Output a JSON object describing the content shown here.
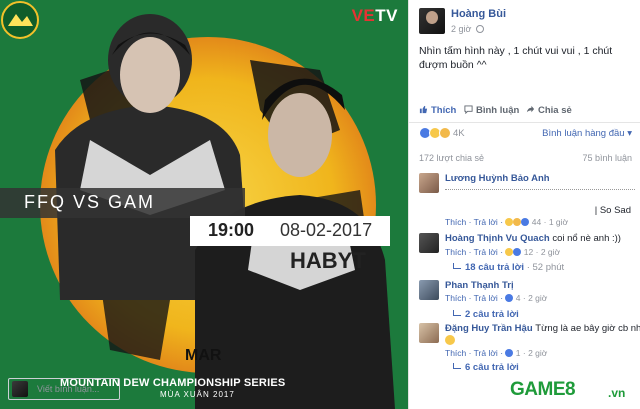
{
  "poster": {
    "watermark_brand": "VE",
    "watermark_brand_tv": "TV",
    "matchup": "FFQ VS GAM",
    "time": "19:00",
    "date": "08-02-2017",
    "jersey_text": "HABYT",
    "jersey_text2": "MAR",
    "event_name": "MOUNTAIN DEW CHAMPIONSHIP SERIES",
    "event_season": "MÙA XUÂN 2017",
    "colors": {
      "green": "#1c7a3c",
      "yellow": "#f3c21a",
      "orange": "#e98a1c"
    }
  },
  "post": {
    "author": "Hoàng Bùi",
    "time": "2 giờ",
    "text": "Nhìn tấm hình này , 1 chút vui vui , 1 chút đượm buồn ^^",
    "actions": {
      "like": "Thích",
      "comment": "Bình luận",
      "share": "Chia sẻ"
    },
    "reactions_count": "4K",
    "sort_label": "Bình luận hàng đầu ▾",
    "shares": "172 lượt chia sẻ",
    "comments_count": "75 bình luận",
    "write_placeholder": "Viết bình luận..."
  },
  "comments": [
    {
      "name": "Lương Huỳnh Bảo Anh",
      "text": "",
      "extra_text": "| So Sad",
      "like": "Thích",
      "reply": "Trả lời",
      "reacts": "44",
      "time": "1 giờ"
    },
    {
      "name": "Hoàng Thịnh Vu Quach",
      "text": "coi nổ nè anh :))",
      "like": "Thích",
      "reply": "Trả lời",
      "reacts": "12",
      "time": "2 giờ",
      "replies_link": "18 câu trả lời",
      "replies_time": "52 phút"
    },
    {
      "name": "Phan Thạnh Trị",
      "text": "",
      "like": "Thích",
      "reply": "Trả lời",
      "reacts": "4",
      "time": "2 giờ",
      "replies_link": "2 câu trả lời"
    },
    {
      "name": "Đặng Huy Trần Hậu",
      "text": "Từng là ae bây giờ cb nhau",
      "like": "Thích",
      "reply": "Trả lời",
      "reacts": "1",
      "time": "2 giờ",
      "replies_link": "6 câu trả lời"
    }
  ],
  "site_watermark": {
    "brand": "GAME8",
    "tld": ".vn",
    "color": "#1f9b3a"
  }
}
